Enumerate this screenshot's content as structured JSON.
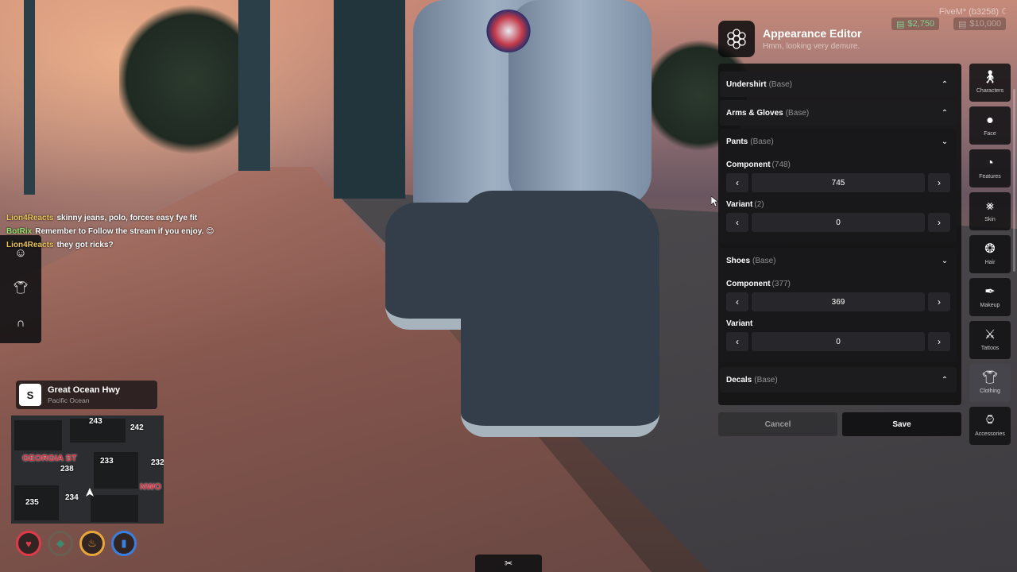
{
  "server": "FiveM* (b3258) ☾",
  "money": {
    "cash": "$2,750",
    "bank": "$10,000"
  },
  "editor": {
    "title": "Appearance Editor",
    "subtitle": "Hmm, looking very demure.",
    "sections": {
      "undershirt": {
        "name": "Undershirt",
        "tag": "(Base)"
      },
      "arms": {
        "name": "Arms & Gloves",
        "tag": "(Base)"
      },
      "pants": {
        "name": "Pants",
        "tag": "(Base)",
        "component_label": "Component",
        "component_count": "(748)",
        "component_value": "745",
        "variant_label": "Variant",
        "variant_count": "(2)",
        "variant_value": "0"
      },
      "shoes": {
        "name": "Shoes",
        "tag": "(Base)",
        "component_label": "Component",
        "component_count": "(377)",
        "component_value": "369",
        "variant_label": "Variant",
        "variant_value": "0"
      },
      "decals": {
        "name": "Decals",
        "tag": "(Base)"
      }
    },
    "cancel_label": "Cancel",
    "save_label": "Save"
  },
  "categories": [
    {
      "label": "Characters",
      "icon": "person-icon"
    },
    {
      "label": "Face",
      "icon": "face-icon"
    },
    {
      "label": "Features",
      "icon": "features-icon"
    },
    {
      "label": "Skin",
      "icon": "dna-icon"
    },
    {
      "label": "Hair",
      "icon": "hair-icon"
    },
    {
      "label": "Makeup",
      "icon": "brush-icon"
    },
    {
      "label": "Tattoos",
      "icon": "tattoo-icon"
    },
    {
      "label": "Clothing",
      "icon": "shirt-icon"
    },
    {
      "label": "Accessories",
      "icon": "watch-icon"
    }
  ],
  "active_category": "Clothing",
  "chat": [
    {
      "user": "Lion4Reacts",
      "text": "skinny jeans, polo, forces easy fye fit"
    },
    {
      "user": "BotRix",
      "text": "Remember to Follow the stream if you enjoy. 😊"
    },
    {
      "user": "Lion4Reacts",
      "text": "they got ricks?"
    }
  ],
  "location": {
    "compass": "S",
    "street": "Great Ocean Hwy",
    "zone": "Pacific Ocean"
  },
  "minimap": {
    "labels": [
      "243",
      "242",
      "233",
      "238",
      "235",
      "234",
      "232"
    ],
    "streets": [
      "GEORGIA ST",
      "NWO"
    ]
  },
  "colors": {
    "health": "#e0394b",
    "armor": "#3b8c6e",
    "hunger": "#e8a63a",
    "thirst": "#3a7fe0"
  }
}
